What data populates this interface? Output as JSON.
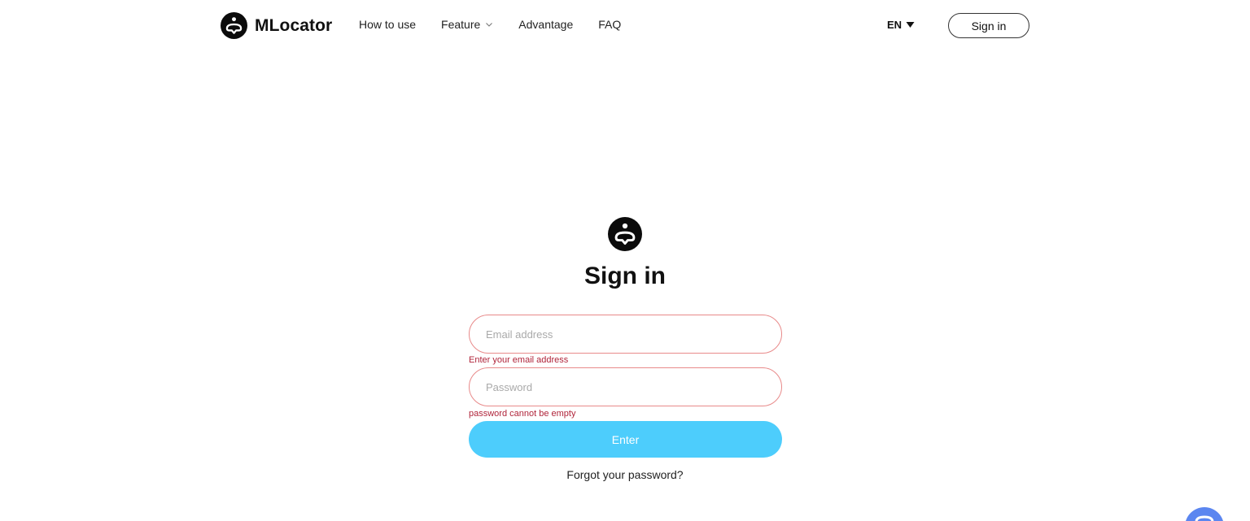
{
  "header": {
    "brand": "MLocator",
    "nav": [
      {
        "label": "How to use"
      },
      {
        "label": "Feature",
        "has_dropdown": true
      },
      {
        "label": "Advantage"
      },
      {
        "label": "FAQ"
      }
    ],
    "language": "EN",
    "signin_label": "Sign in"
  },
  "form": {
    "title": "Sign in",
    "email_placeholder": "Email address",
    "email_error": "Enter your email address",
    "password_placeholder": "Password",
    "password_error": "password cannot be empty",
    "enter_label": "Enter",
    "forgot_label": "Forgot your password?"
  },
  "colors": {
    "accent": "#4dcdfc",
    "error_border": "#e88a8a",
    "error_text": "#b0243a",
    "chat_bubble": "#5b86f0"
  },
  "icons": {
    "logo": "location-heart-icon",
    "nav_dropdown": "chevron-down-icon",
    "language_dropdown": "caret-down-icon",
    "support": "chat-bubble-icon"
  }
}
